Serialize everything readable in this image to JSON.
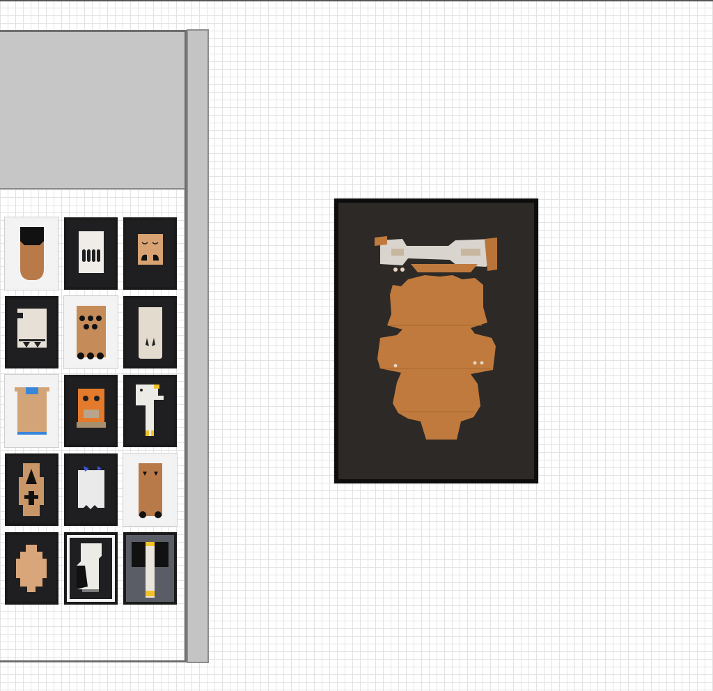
{
  "colors": {
    "kraft": "#c07a3e",
    "kraft_light": "#d29a66",
    "kraft_pale": "#ddb48a",
    "white_card": "#e9e4dc",
    "black_mat": "#1f1f21",
    "dark_mat": "#2d2926",
    "blue": "#3a86d8",
    "yellow": "#f2c22a",
    "orange": "#e47a2b",
    "panel_gray": "#c6c6c6",
    "scrollbar_gray": "#c4c4c4"
  },
  "gallery": {
    "thumbnails": [
      {
        "frame": "white",
        "mat": "#f3f3f3",
        "icon": "cut-cardboard-artwork-icon"
      },
      {
        "frame": "black",
        "mat": "#1f1f21",
        "icon": "cut-cardboard-artwork-icon"
      },
      {
        "frame": "black",
        "mat": "#1f1f21",
        "icon": "cut-cardboard-artwork-icon"
      },
      {
        "frame": "black",
        "mat": "#1f1f21",
        "icon": "cut-cardboard-artwork-icon"
      },
      {
        "frame": "white",
        "mat": "#f3f3f3",
        "icon": "cut-cardboard-artwork-icon"
      },
      {
        "frame": "black",
        "mat": "#1f1f21",
        "icon": "cut-cardboard-artwork-icon"
      },
      {
        "frame": "white",
        "mat": "#f3f3f3",
        "icon": "cut-cardboard-artwork-icon"
      },
      {
        "frame": "black",
        "mat": "#1f1f21",
        "icon": "cut-cardboard-artwork-icon"
      },
      {
        "frame": "black",
        "mat": "#1f1f21",
        "icon": "cut-cardboard-artwork-icon"
      },
      {
        "frame": "black",
        "mat": "#1f1f21",
        "icon": "cut-cardboard-artwork-icon"
      },
      {
        "frame": "black",
        "mat": "#1f1f21",
        "icon": "cut-cardboard-artwork-icon"
      },
      {
        "frame": "white",
        "mat": "#f3f3f3",
        "icon": "cut-cardboard-artwork-icon"
      },
      {
        "frame": "black",
        "mat": "#1f1f21",
        "icon": "cut-cardboard-artwork-icon"
      },
      {
        "frame": "black",
        "mat": "#1f1f21",
        "icon": "cut-cardboard-artwork-icon"
      },
      {
        "frame": "black",
        "mat": "#1f1f21",
        "icon": "cut-cardboard-artwork-icon"
      }
    ]
  },
  "selected_artwork": {
    "icon": "cut-cardboard-artwork-icon",
    "frame": "black",
    "mat": "#2d2926"
  }
}
